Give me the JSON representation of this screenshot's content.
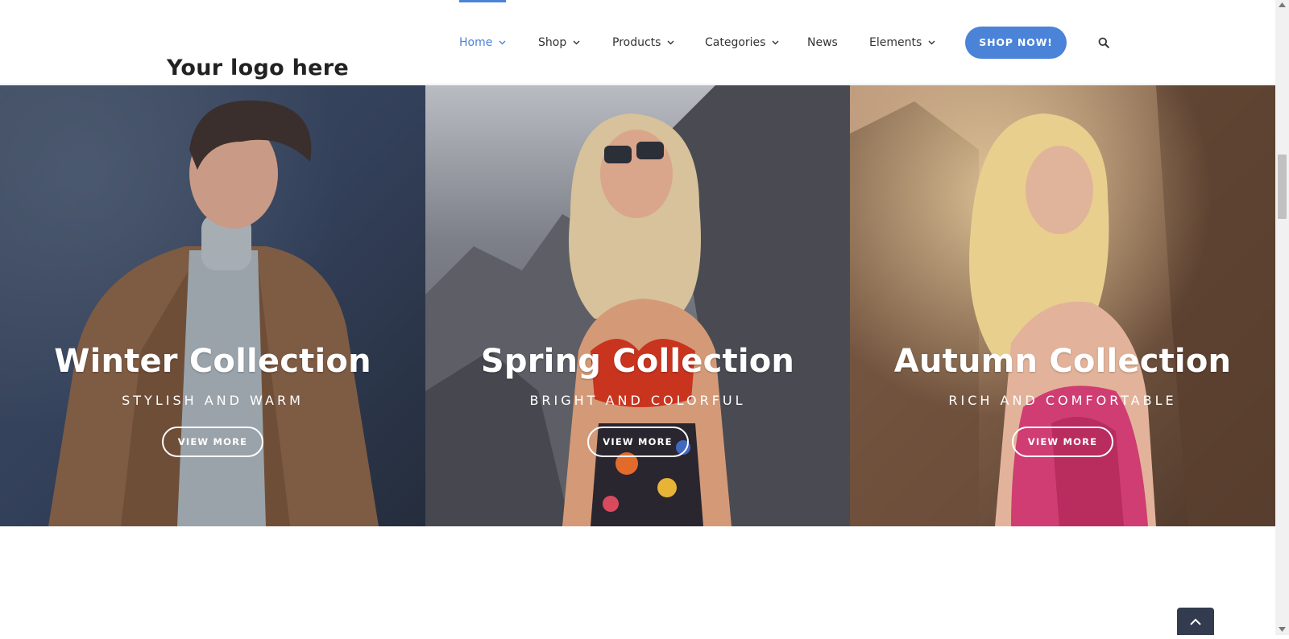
{
  "header": {
    "logo": "Your logo here",
    "nav": [
      {
        "label": "Home",
        "active": true,
        "has_dropdown": true
      },
      {
        "label": "Shop",
        "has_dropdown": true
      },
      {
        "label": "Products",
        "has_dropdown": true
      },
      {
        "label": "Categories",
        "has_dropdown": true
      },
      {
        "label": "News",
        "has_dropdown": false
      },
      {
        "label": "Elements",
        "has_dropdown": true
      }
    ],
    "cta_label": "SHOP NOW!",
    "search_icon": "search-icon"
  },
  "collections": [
    {
      "title": "Winter Collection",
      "subtitle": "STYLISH AND WARM",
      "button": "VIEW MORE"
    },
    {
      "title": "Spring Collection",
      "subtitle": "BRIGHT AND COLORFUL",
      "button": "VIEW MORE"
    },
    {
      "title": "Autumn Collection",
      "subtitle": "RICH AND COMFORTABLE",
      "button": "VIEW MORE"
    }
  ],
  "back_to_top_icon": "chevron-up-icon",
  "colors": {
    "accent": "#4a83d8",
    "back_to_top": "#333c4e"
  }
}
